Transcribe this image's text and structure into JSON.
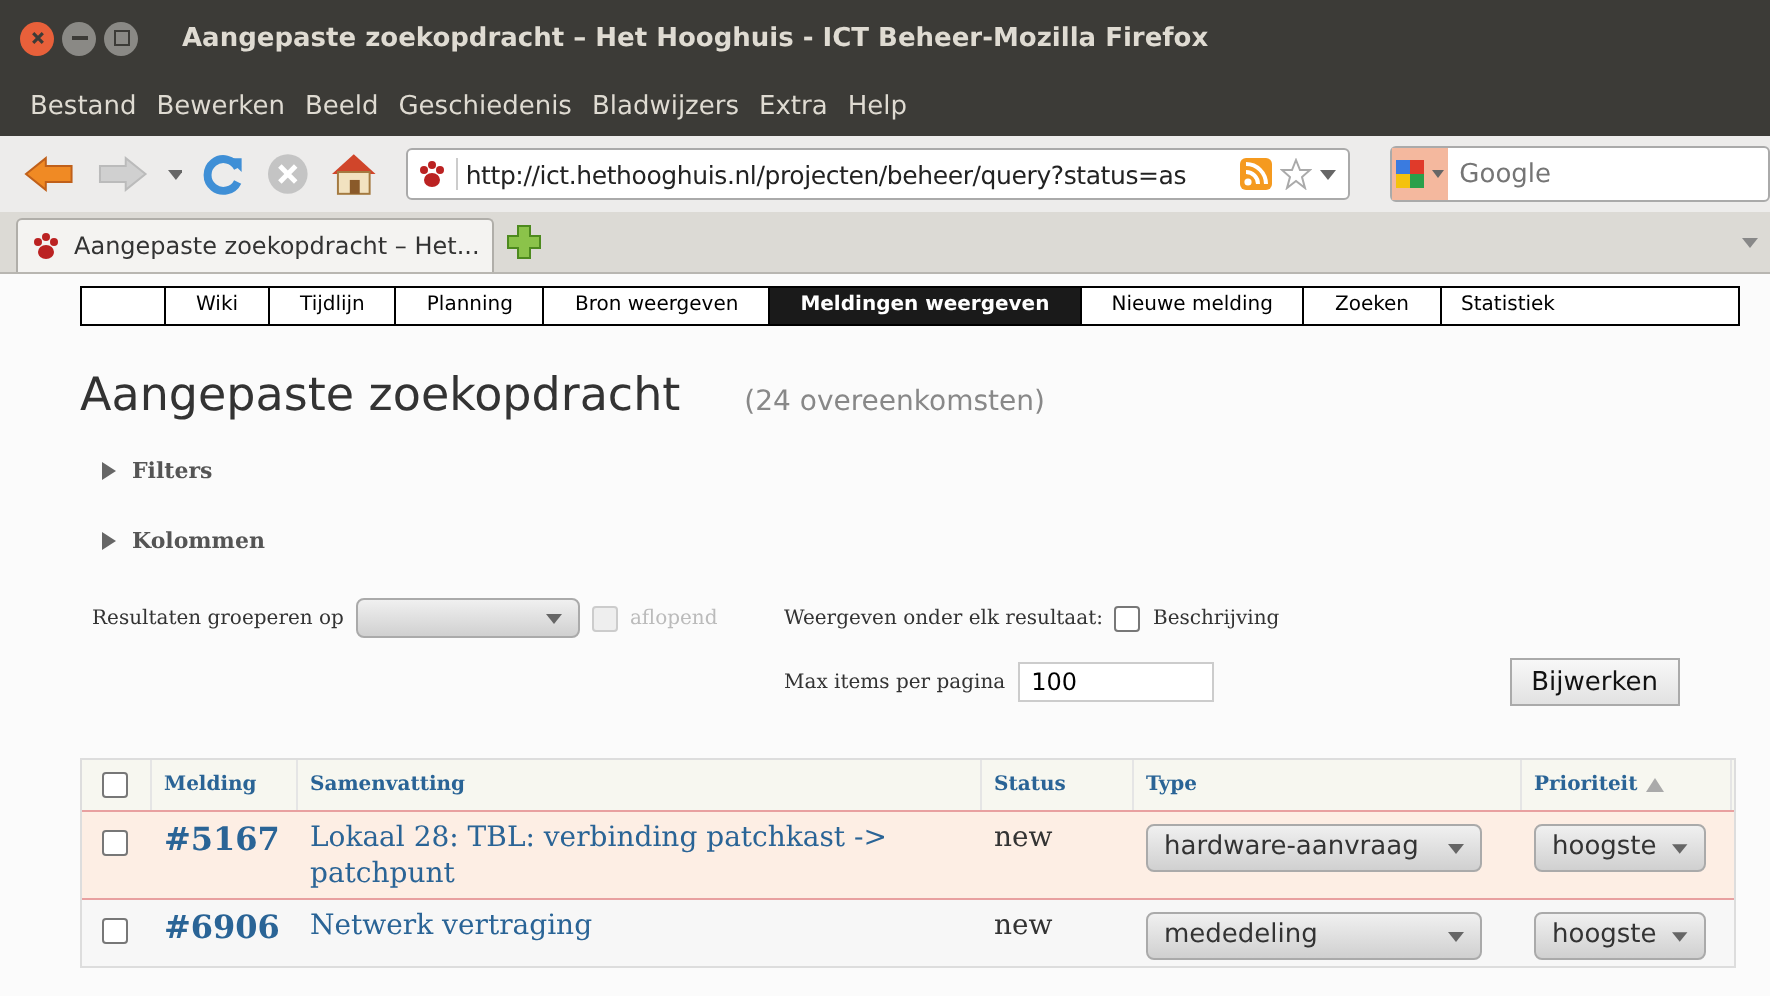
{
  "window": {
    "title": "Aangepaste zoekopdracht – Het Hooghuis - ICT Beheer-Mozilla Firefox"
  },
  "menu": [
    "Bestand",
    "Bewerken",
    "Beeld",
    "Geschiedenis",
    "Bladwijzers",
    "Extra",
    "Help"
  ],
  "toolbar": {
    "back_disabled": false,
    "forward_disabled": true,
    "url": "http://ict.hethooghuis.nl/projecten/beheer/query?status=as",
    "search": {
      "placeholder": "Google"
    }
  },
  "tabs": [
    {
      "label": "Aangepaste zoekopdracht – Het...",
      "selected": true
    }
  ],
  "nav": [
    {
      "label": "Wiki",
      "selected": false
    },
    {
      "label": "Tijdlijn",
      "selected": false
    },
    {
      "label": "Planning",
      "selected": false
    },
    {
      "label": "Bron weergeven",
      "selected": false
    },
    {
      "label": "Meldingen weergeven",
      "selected": true
    },
    {
      "label": "Nieuwe melding",
      "selected": false
    },
    {
      "label": "Zoeken",
      "selected": false
    },
    {
      "label": "Statistiek",
      "selected": false
    }
  ],
  "page": {
    "title": "Aangepaste zoekopdracht",
    "count": "(24 overeenkomsten)",
    "sections": [
      {
        "label": "Filters",
        "expanded": false
      },
      {
        "label": "Kolommen",
        "expanded": false
      }
    ],
    "group_label": "Resultaten groeperen op",
    "descending": {
      "label": "aflopend",
      "checked": false,
      "disabled": true
    },
    "show_label": "Weergeven onder elk resultaat:",
    "description": {
      "label": "Beschrijving",
      "checked": false
    },
    "max_label": "Max items per pagina",
    "max_value": "100",
    "update_button": "Bijwerken"
  },
  "table": {
    "select_all_checked": false,
    "columns": [
      {
        "label": "Melding",
        "sorted": false
      },
      {
        "label": "Samenvatting",
        "sorted": false
      },
      {
        "label": "Status",
        "sorted": false
      },
      {
        "label": "Type",
        "sorted": false
      },
      {
        "label": "Prioriteit",
        "sorted": true
      }
    ],
    "rows": [
      {
        "checked": false,
        "color": "#fdeee4",
        "id": "#5167",
        "summary": "Lokaal 28: TBL: verbinding patchkast -> patchpunt",
        "status": "new",
        "type": "hardware-aanvraag",
        "priority": "hoogste"
      },
      {
        "checked": false,
        "color": "#f7f7f7",
        "id": "#6906",
        "summary": "Netwerk vertraging",
        "status": "new",
        "type": "mededeling",
        "priority": "hoogste"
      }
    ]
  }
}
